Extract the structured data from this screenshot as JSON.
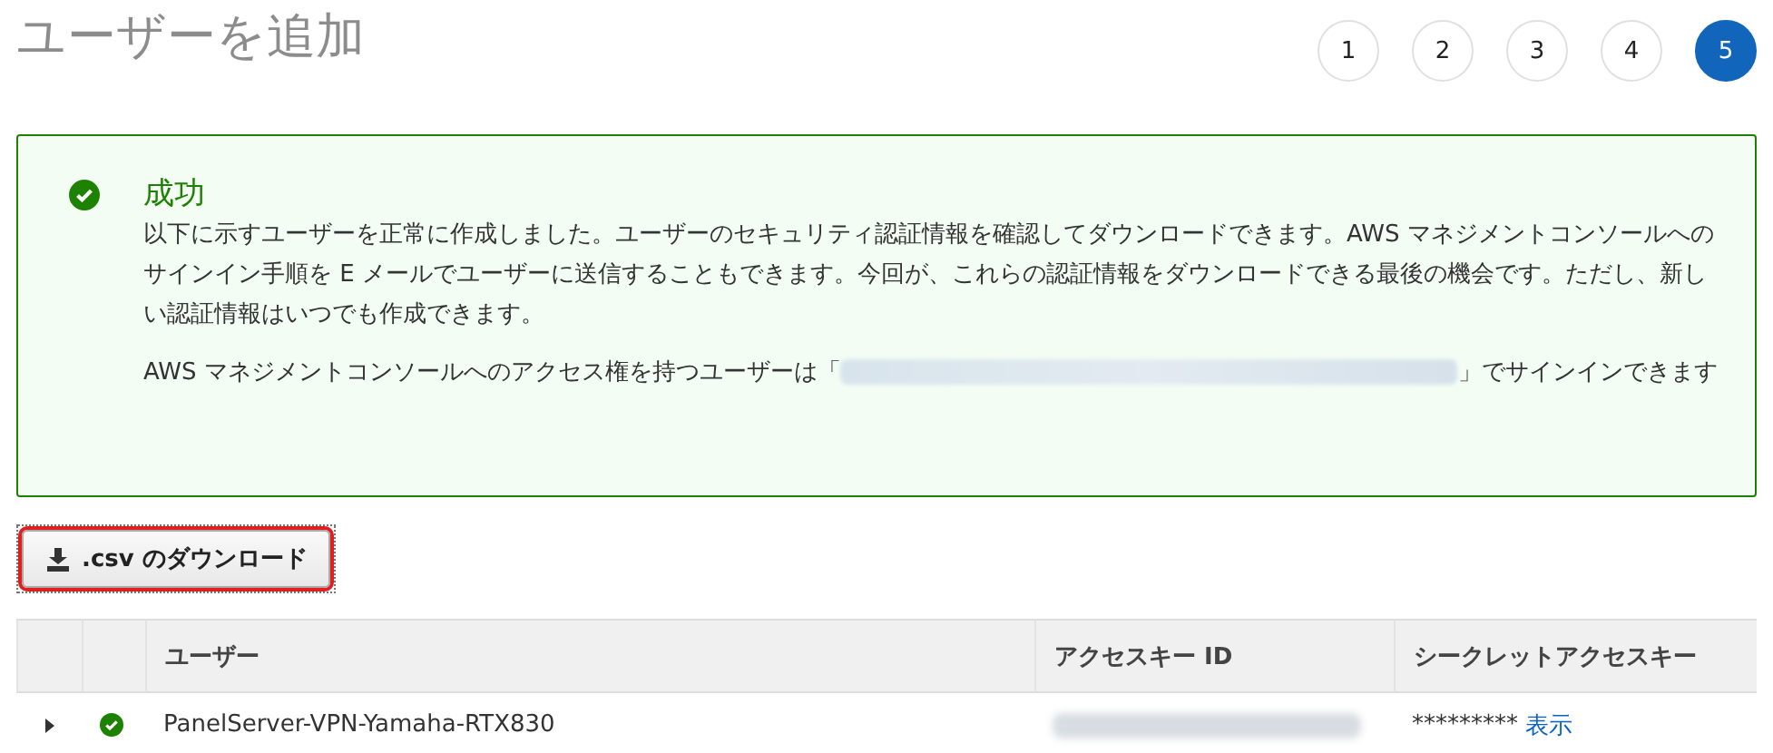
{
  "page_title": "ユーザーを追加",
  "steps": [
    {
      "label": "1",
      "selected": false
    },
    {
      "label": "2",
      "selected": false
    },
    {
      "label": "3",
      "selected": false
    },
    {
      "label": "4",
      "selected": false
    },
    {
      "label": "5",
      "selected": true
    }
  ],
  "alert": {
    "title": "成功",
    "message": "以下に示すユーザーを正常に作成しました。ユーザーのセキュリティ認証情報を確認してダウンロードできます。AWS マネジメントコンソールへのサインイン手順を E メールでユーザーに送信することもできます。今回が、これらの認証情報をダウンロードできる最後の機会です。ただし、新しい認証情報はいつでも作成できます。",
    "signin_before": "AWS マネジメントコンソールへのアクセス権を持つユーザーは「",
    "signin_after": "」でサインインできます"
  },
  "download_button": ".csv のダウンロード",
  "table": {
    "columns": [
      "ユーザー",
      "アクセスキー ID",
      "シークレットアクセスキー"
    ],
    "rows": [
      {
        "expanded": false,
        "user": "PanelServer-VPN-Yamaha-RTX830",
        "secret": "*********",
        "show_link": "表示"
      }
    ]
  }
}
